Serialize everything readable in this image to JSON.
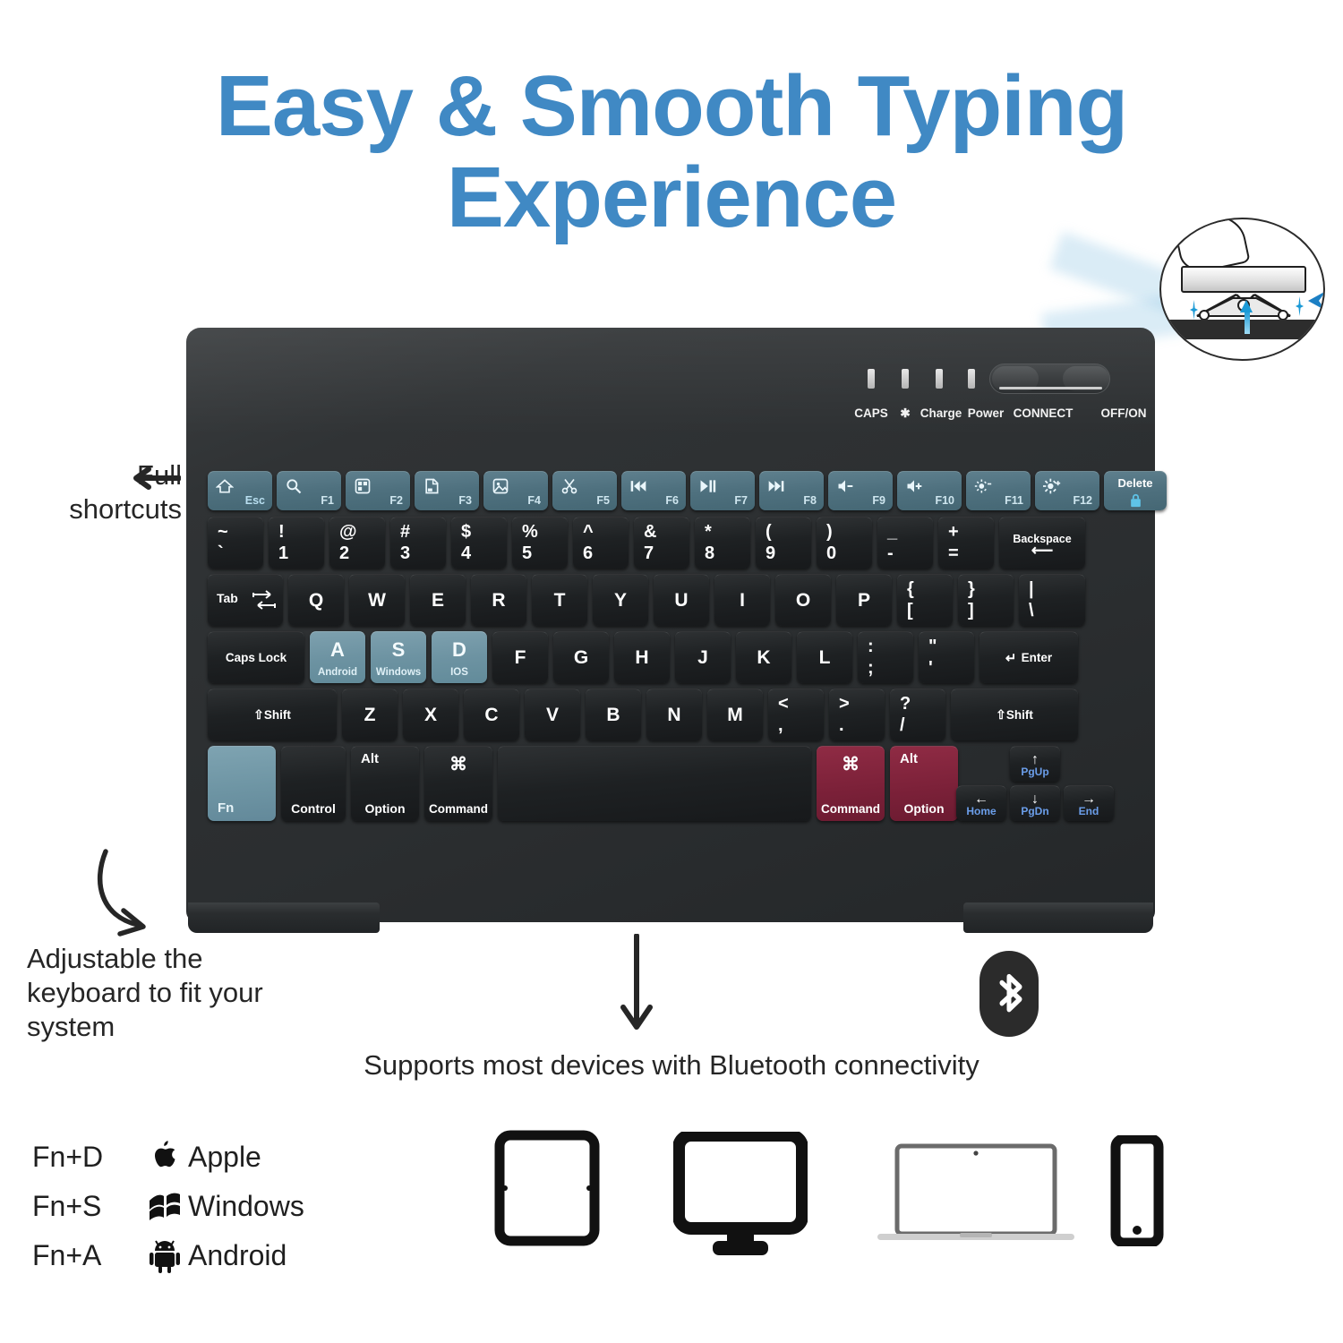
{
  "title": {
    "line1": "Easy & Smooth Typing",
    "line2": "Experience"
  },
  "colors": {
    "title_blue": "#4089c4",
    "key_teal": "#6d93a2",
    "key_red": "#7c2139",
    "key_black": "#1e2123",
    "accent_blue": "#1b9ad6",
    "arrow_label_blue": "#6b9eea"
  },
  "annotations": {
    "full_shortcuts_line1": "Full",
    "full_shortcuts_line2": "shortcuts",
    "adjustable_line1": "Adjustable the",
    "adjustable_line2": "keyboard to fit your",
    "adjustable_line3": "system",
    "bluetooth_caption": "Supports most devices with Bluetooth connectivity"
  },
  "keyboard": {
    "status": {
      "labels": [
        "CAPS",
        "✱",
        "Charge",
        "Power",
        "CONNECT",
        "OFF/ON"
      ]
    },
    "function_row": [
      {
        "name": "esc-key",
        "icon": "home-icon",
        "fnum": "Esc"
      },
      {
        "name": "f1-key",
        "icon": "search-icon",
        "fnum": "F1"
      },
      {
        "name": "f2-key",
        "icon": "app-grid-icon",
        "fnum": "F2"
      },
      {
        "name": "f3-key",
        "icon": "document-icon",
        "fnum": "F3"
      },
      {
        "name": "f4-key",
        "icon": "screenshot-icon",
        "fnum": "F4"
      },
      {
        "name": "f5-key",
        "icon": "scissors-icon",
        "fnum": "F5"
      },
      {
        "name": "f6-key",
        "icon": "prev-track-icon",
        "fnum": "F6"
      },
      {
        "name": "f7-key",
        "icon": "play-pause-icon",
        "fnum": "F7"
      },
      {
        "name": "f8-key",
        "icon": "next-track-icon",
        "fnum": "F8"
      },
      {
        "name": "f9-key",
        "icon": "volume-down-icon",
        "fnum": "F9"
      },
      {
        "name": "f10-key",
        "icon": "volume-up-icon",
        "fnum": "F10"
      },
      {
        "name": "f11-key",
        "icon": "brightness-down-icon",
        "fnum": "F11"
      },
      {
        "name": "f12-key",
        "icon": "brightness-up-icon",
        "fnum": "F12"
      }
    ],
    "delete_key": {
      "label": "Delete",
      "sub": "lock-icon"
    },
    "number_row": [
      {
        "top": "~",
        "bottom": "`"
      },
      {
        "top": "!",
        "bottom": "1"
      },
      {
        "top": "@",
        "bottom": "2"
      },
      {
        "top": "#",
        "bottom": "3"
      },
      {
        "top": "$",
        "bottom": "4"
      },
      {
        "top": "%",
        "bottom": "5"
      },
      {
        "top": "^",
        "bottom": "6"
      },
      {
        "top": "&",
        "bottom": "7"
      },
      {
        "top": "*",
        "bottom": "8"
      },
      {
        "top": "(",
        "bottom": "9"
      },
      {
        "top": ")",
        "bottom": "0"
      },
      {
        "top": "_",
        "bottom": "-"
      },
      {
        "top": "+",
        "bottom": "="
      }
    ],
    "backspace_label": "Backspace",
    "tab_label": "Tab",
    "qwerty_row": [
      "Q",
      "W",
      "E",
      "R",
      "T",
      "Y",
      "U",
      "I",
      "O",
      "P"
    ],
    "qwerty_brackets": [
      {
        "top": "{",
        "bottom": "["
      },
      {
        "top": "}",
        "bottom": "]"
      },
      {
        "top": "|",
        "bottom": "\\"
      }
    ],
    "caps_lock_label": "Caps Lock",
    "home_row_os": [
      {
        "letter": "A",
        "os": "Android"
      },
      {
        "letter": "S",
        "os": "Windows"
      },
      {
        "letter": "D",
        "os": "IOS"
      }
    ],
    "home_row": [
      "F",
      "G",
      "H",
      "J",
      "K",
      "L"
    ],
    "home_row_punct": [
      {
        "top": ":",
        "bottom": ";"
      },
      {
        "top": "\"",
        "bottom": "'"
      }
    ],
    "enter_label": "Enter",
    "shift_left_label": "Shift",
    "shift_right_label": "Shift",
    "zxcv_row": [
      "Z",
      "X",
      "C",
      "V",
      "B",
      "N",
      "M"
    ],
    "zxcv_punct": [
      {
        "top": "<",
        "bottom": ","
      },
      {
        "top": ">",
        "bottom": "."
      },
      {
        "top": "?",
        "bottom": "/"
      }
    ],
    "bottom_row": {
      "fn_label": "Fn",
      "control_label": "Control",
      "alt_top": "Alt",
      "option_bottom": "Option",
      "cmd_top": "⌘",
      "command_bottom": "Command",
      "space_label": "",
      "red_cmd_top": "⌘",
      "red_cmd_bottom": "Command",
      "red_alt_top": "Alt",
      "red_alt_bottom": "Option"
    },
    "arrow_keys": [
      {
        "name": "arrow-up-pgup",
        "glyph": "↑",
        "label": "PgUp"
      },
      {
        "name": "arrow-down-pgdn",
        "glyph": "↓",
        "label": "PgDn"
      },
      {
        "name": "arrow-left-home",
        "glyph": "←",
        "label": "Home"
      },
      {
        "name": "arrow-right-end",
        "glyph": "→",
        "label": "End"
      }
    ]
  },
  "legend": [
    {
      "combo": "Fn+D",
      "icon": "apple-icon",
      "name": "Apple"
    },
    {
      "combo": "Fn+S",
      "icon": "windows-icon",
      "name": "Windows"
    },
    {
      "combo": "Fn+A",
      "icon": "android-icon",
      "name": "Android"
    }
  ],
  "devices": [
    "tablet-icon",
    "monitor-icon",
    "laptop-icon",
    "phone-icon"
  ]
}
